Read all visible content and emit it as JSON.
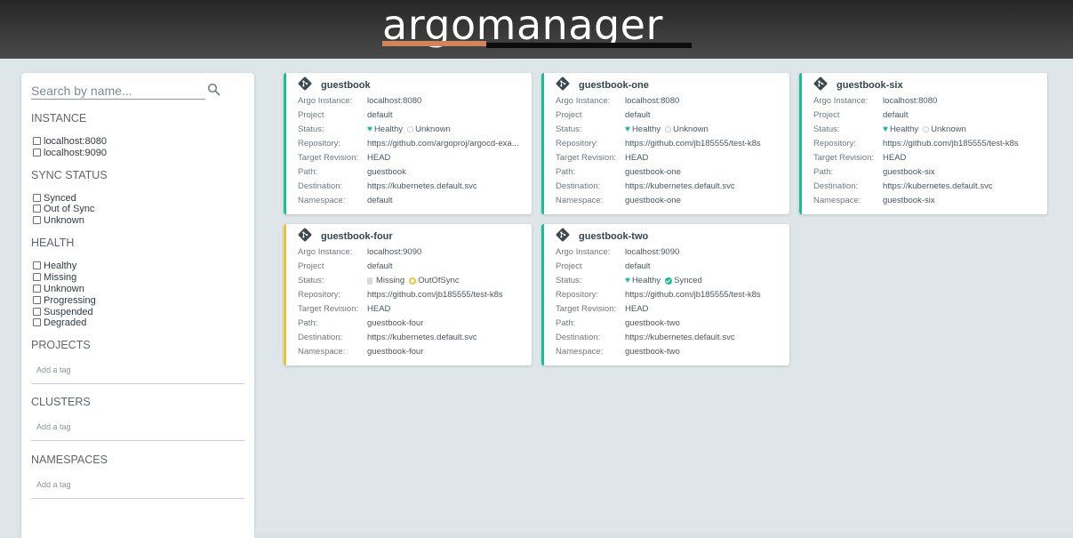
{
  "header": {
    "logo_text": "argomanager"
  },
  "sidebar": {
    "search_placeholder": "Search by name...",
    "instance": {
      "title": "INSTANCE",
      "options": [
        "localhost:8080",
        "localhost:9090"
      ]
    },
    "sync_status": {
      "title": "SYNC STATUS",
      "options": [
        "Synced",
        "Out of Sync",
        "Unknown"
      ]
    },
    "health": {
      "title": "HEALTH",
      "options": [
        "Healthy",
        "Missing",
        "Unknown",
        "Progressing",
        "Suspended",
        "Degraded"
      ]
    },
    "projects": {
      "title": "PROJECTS",
      "tag_placeholder": "Add a tag"
    },
    "clusters": {
      "title": "CLUSTERS",
      "tag_placeholder": "Add a tag"
    },
    "namespaces": {
      "title": "NAMESPACES",
      "tag_placeholder": "Add a tag"
    }
  },
  "labels": {
    "instance": "Argo Instance:",
    "project": "Project",
    "status": "Status:",
    "repository": "Repository:",
    "revision": "Target Revision:",
    "path": "Path:",
    "destination": "Destination:",
    "namespace": "Namespace:"
  },
  "colors": {
    "healthy": "#18be94",
    "degraded": "#f4c030",
    "logo_orange": "#d4845c"
  },
  "cards": [
    {
      "name": "guestbook",
      "instance": "localhost:8080",
      "project": "default",
      "health": "Healthy",
      "sync": "Unknown",
      "repository": "https://github.com/argoproj/argocd-exa...",
      "revision": "HEAD",
      "path": "guestbook",
      "destination": "https://kubernetes.default.svc",
      "namespace": "default"
    },
    {
      "name": "guestbook-one",
      "instance": "localhost:8080",
      "project": "default",
      "health": "Healthy",
      "sync": "Unknown",
      "repository": "https://github.com/jb185555/test-k8s",
      "revision": "HEAD",
      "path": "guestbook-one",
      "destination": "https://kubernetes.default.svc",
      "namespace": "guestbook-one"
    },
    {
      "name": "guestbook-six",
      "instance": "localhost:8080",
      "project": "default",
      "health": "Healthy",
      "sync": "Unknown",
      "repository": "https://github.com/jb185555/test-k8s",
      "revision": "HEAD",
      "path": "guestbook-six",
      "destination": "https://kubernetes.default.svc",
      "namespace": "guestbook-six"
    },
    {
      "name": "guestbook-four",
      "instance": "localhost:9090",
      "project": "default",
      "health": "Missing",
      "sync": "OutOfSync",
      "repository": "https://github.com/jb185555/test-k8s",
      "revision": "HEAD",
      "path": "guestbook-four",
      "destination": "https://kubernetes.default.svc",
      "namespace": "guestbook-four"
    },
    {
      "name": "guestbook-two",
      "instance": "localhost:9090",
      "project": "default",
      "health": "Healthy",
      "sync": "Synced",
      "repository": "https://github.com/jb185555/test-k8s",
      "revision": "HEAD",
      "path": "guestbook-two",
      "destination": "https://kubernetes.default.svc",
      "namespace": "guestbook-two"
    }
  ]
}
